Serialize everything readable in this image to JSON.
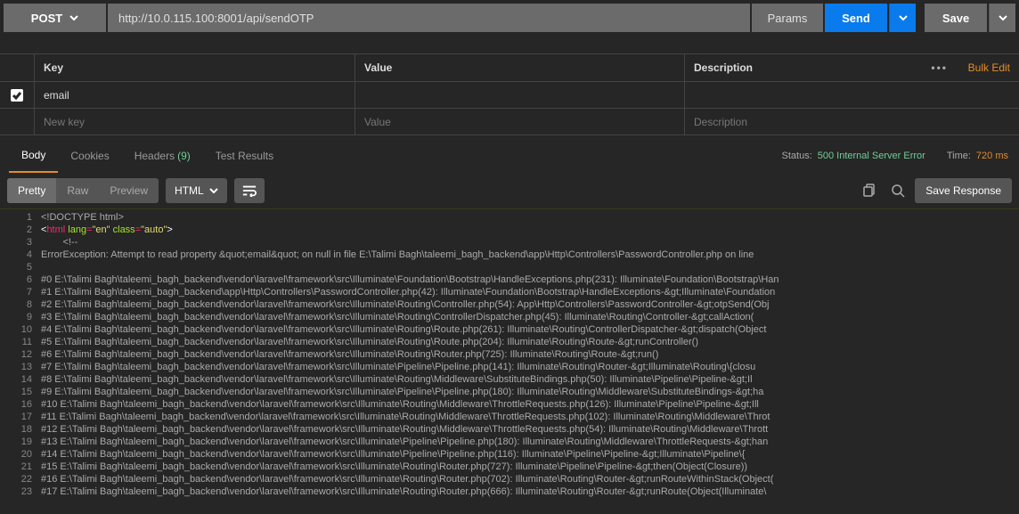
{
  "request": {
    "method": "POST",
    "url": "http://10.0.115.100:8001/api/sendOTP",
    "paramsLabel": "Params",
    "sendLabel": "Send",
    "saveLabel": "Save"
  },
  "paramsTable": {
    "headers": {
      "key": "Key",
      "value": "Value",
      "description": "Description"
    },
    "bulkEdit": "Bulk Edit",
    "rows": [
      {
        "checked": true,
        "key": "email",
        "value": "",
        "description": ""
      }
    ],
    "placeholder": {
      "key": "New key",
      "value": "Value",
      "description": "Description"
    }
  },
  "responseTabs": {
    "body": "Body",
    "cookies": "Cookies",
    "headers": "Headers",
    "headersCount": "(9)",
    "testResults": "Test Results"
  },
  "status": {
    "statusLabel": "Status:",
    "statusValue": "500 Internal Server Error",
    "timeLabel": "Time:",
    "timeValue": "720 ms"
  },
  "viewer": {
    "prettyLabel": "Pretty",
    "rawLabel": "Raw",
    "previewLabel": "Preview",
    "language": "HTML",
    "saveResponse": "Save Response"
  },
  "code": {
    "line1": "<!DOCTYPE html>",
    "line2_tag_open": "<",
    "line2_tag": "html",
    "line2_attr1": "lang",
    "line2_eq": "=",
    "line2_val1": "\"en\"",
    "line2_attr2": "class",
    "line2_val2": "\"auto\"",
    "line2_close": ">",
    "line3": "        <!--",
    "line4": "ErrorException: Attempt to read property &quot;email&quot; on null in file E:\\Talimi Bagh\\taleemi_bagh_backend\\app\\Http\\Controllers\\PasswordController.php on line",
    "line5": "",
    "line6": "#0 E:\\Talimi Bagh\\taleemi_bagh_backend\\vendor\\laravel\\framework\\src\\Illuminate\\Foundation\\Bootstrap\\HandleExceptions.php(231): Illuminate\\Foundation\\Bootstrap\\Han",
    "line7": "#1 E:\\Talimi Bagh\\taleemi_bagh_backend\\app\\Http\\Controllers\\PasswordController.php(42): Illuminate\\Foundation\\Bootstrap\\HandleExceptions-&gt;Illuminate\\Foundation",
    "line8": "#2 E:\\Talimi Bagh\\taleemi_bagh_backend\\vendor\\laravel\\framework\\src\\Illuminate\\Routing\\Controller.php(54): App\\Http\\Controllers\\PasswordController-&gt;otpSend(Obj",
    "line9": "#3 E:\\Talimi Bagh\\taleemi_bagh_backend\\vendor\\laravel\\framework\\src\\Illuminate\\Routing\\ControllerDispatcher.php(45): Illuminate\\Routing\\Controller-&gt;callAction(",
    "line10": "#4 E:\\Talimi Bagh\\taleemi_bagh_backend\\vendor\\laravel\\framework\\src\\Illuminate\\Routing\\Route.php(261): Illuminate\\Routing\\ControllerDispatcher-&gt;dispatch(Object",
    "line11": "#5 E:\\Talimi Bagh\\taleemi_bagh_backend\\vendor\\laravel\\framework\\src\\Illuminate\\Routing\\Route.php(204): Illuminate\\Routing\\Route-&gt;runController()",
    "line12": "#6 E:\\Talimi Bagh\\taleemi_bagh_backend\\vendor\\laravel\\framework\\src\\Illuminate\\Routing\\Router.php(725): Illuminate\\Routing\\Route-&gt;run()",
    "line13": "#7 E:\\Talimi Bagh\\taleemi_bagh_backend\\vendor\\laravel\\framework\\src\\Illuminate\\Pipeline\\Pipeline.php(141): Illuminate\\Routing\\Router-&gt;Illuminate\\Routing\\{closu",
    "line14": "#8 E:\\Talimi Bagh\\taleemi_bagh_backend\\vendor\\laravel\\framework\\src\\Illuminate\\Routing\\Middleware\\SubstituteBindings.php(50): Illuminate\\Pipeline\\Pipeline-&gt;Il",
    "line15": "#9 E:\\Talimi Bagh\\taleemi_bagh_backend\\vendor\\laravel\\framework\\src\\Illuminate\\Pipeline\\Pipeline.php(180): Illuminate\\Routing\\Middleware\\SubstituteBindings-&gt;ha",
    "line16": "#10 E:\\Talimi Bagh\\taleemi_bagh_backend\\vendor\\laravel\\framework\\src\\Illuminate\\Routing\\Middleware\\ThrottleRequests.php(126): Illuminate\\Pipeline\\Pipeline-&gt;Ill",
    "line17": "#11 E:\\Talimi Bagh\\taleemi_bagh_backend\\vendor\\laravel\\framework\\src\\Illuminate\\Routing\\Middleware\\ThrottleRequests.php(102): Illuminate\\Routing\\Middleware\\Throt",
    "line18": "#12 E:\\Talimi Bagh\\taleemi_bagh_backend\\vendor\\laravel\\framework\\src\\Illuminate\\Routing\\Middleware\\ThrottleRequests.php(54): Illuminate\\Routing\\Middleware\\Thrott",
    "line19": "#13 E:\\Talimi Bagh\\taleemi_bagh_backend\\vendor\\laravel\\framework\\src\\Illuminate\\Pipeline\\Pipeline.php(180): Illuminate\\Routing\\Middleware\\ThrottleRequests-&gt;han",
    "line20": "#14 E:\\Talimi Bagh\\taleemi_bagh_backend\\vendor\\laravel\\framework\\src\\Illuminate\\Pipeline\\Pipeline.php(116): Illuminate\\Pipeline\\Pipeline-&gt;Illuminate\\Pipeline\\{",
    "line21": "#15 E:\\Talimi Bagh\\taleemi_bagh_backend\\vendor\\laravel\\framework\\src\\Illuminate\\Routing\\Router.php(727): Illuminate\\Pipeline\\Pipeline-&gt;then(Object(Closure))",
    "line22": "#16 E:\\Talimi Bagh\\taleemi_bagh_backend\\vendor\\laravel\\framework\\src\\Illuminate\\Routing\\Router.php(702): Illuminate\\Routing\\Router-&gt;runRouteWithinStack(Object(",
    "line23": "#17 E:\\Talimi Bagh\\taleemi_bagh_backend\\vendor\\laravel\\framework\\src\\Illuminate\\Routing\\Router.php(666): Illuminate\\Routing\\Router-&gt;runRoute(Object(Illuminate\\"
  }
}
